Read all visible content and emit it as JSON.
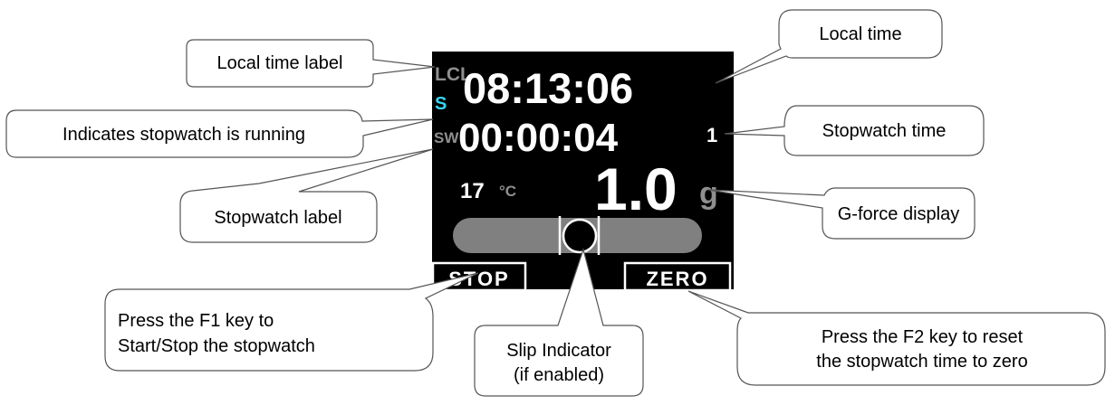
{
  "display": {
    "lcl_label": "LCL",
    "local_time": "08:13:06",
    "running_indicator": "S",
    "sw_label": "SW",
    "stopwatch_time": "00:00:04",
    "stopwatch_tenths": "1",
    "temperature": "17",
    "temperature_unit": "°C",
    "g_force": "1.0",
    "g_unit": "g",
    "f1_key_label": "STOP",
    "f2_key_label": "ZERO",
    "slip_ball_offset": 0,
    "colors": {
      "background": "#000000",
      "text": "#ffffff",
      "dim": "#8f8f8f",
      "running": "#34d8f2",
      "slip_bar": "#808080"
    }
  },
  "callouts": {
    "local_time_label": "Local time label",
    "local_time": "Local time",
    "stopwatch_running": "Indicates stopwatch is running",
    "stopwatch_time": "Stopwatch time",
    "stopwatch_label": "Stopwatch label",
    "g_force_display": "G-force display",
    "f1_key": [
      "Press the F1 key to",
      "Start/Stop the stopwatch"
    ],
    "slip_indicator": [
      "Slip Indicator",
      "(if enabled)"
    ],
    "f2_key": [
      "Press the F2 key to reset",
      "the stopwatch time to zero"
    ]
  }
}
